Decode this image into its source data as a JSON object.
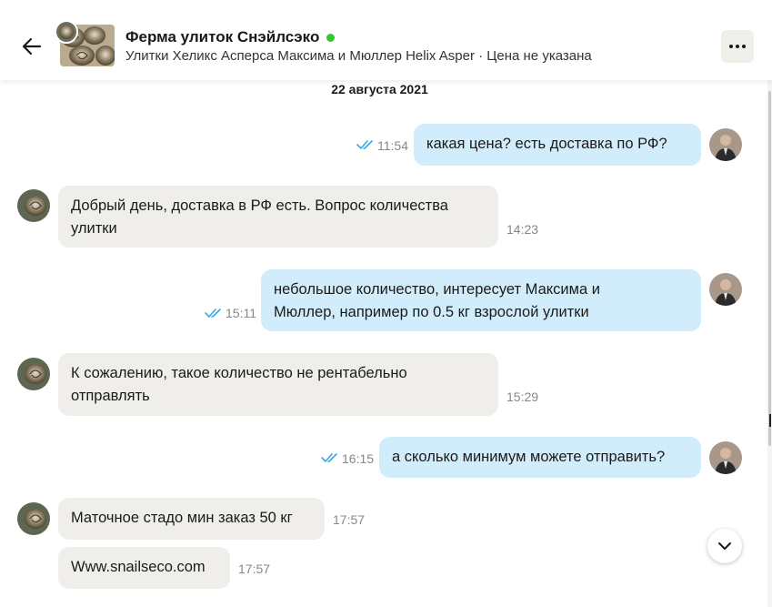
{
  "header": {
    "title": "Ферма улиток Снэйлсэко",
    "subtitle": "Улитки Хеликс Асперса Максима и Мюллер Helix Asper · Цена не указана",
    "online_color": "#32c832"
  },
  "date_separator": "22 августа 2021",
  "messages": [
    {
      "direction": "out",
      "lines": [
        "какая цена? есть доставка по РФ?"
      ],
      "time": "11:54",
      "read": true
    },
    {
      "direction": "in",
      "lines": [
        "Добрый день, доставка в РФ есть. Вопрос количества",
        "улитки"
      ],
      "time": "14:23"
    },
    {
      "direction": "out",
      "lines": [
        "небольшое количество, интересует Максима и",
        "Мюллер, например по 0.5 кг взрослой улитки"
      ],
      "time": "15:11",
      "read": true
    },
    {
      "direction": "in",
      "lines": [
        "К сожалению, такое количество не рентабельно",
        "отправлять"
      ],
      "time": "15:29"
    },
    {
      "direction": "out",
      "lines": [
        "а сколько минимум можете отправить?"
      ],
      "time": "16:15",
      "read": true
    },
    {
      "direction": "in",
      "lines": [
        "Маточное стадо мин заказ 50 кг"
      ],
      "time": "17:57"
    },
    {
      "direction": "in",
      "lines": [
        "Www.snailseco.com"
      ],
      "time": "17:57"
    }
  ],
  "colors": {
    "outgoing_bubble": "#d1ecfb",
    "incoming_bubble": "#f0eeea",
    "read_ticks": "#3ba7e6"
  },
  "icons": {
    "back": "arrow-left-icon",
    "more": "more-horizontal-icon",
    "scroll_down": "chevron-down-icon",
    "read": "double-check-icon"
  }
}
